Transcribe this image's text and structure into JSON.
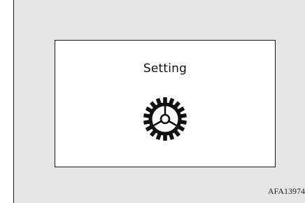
{
  "screen": {
    "title": "Setting",
    "icon": "gear-icon"
  },
  "figure_code": "AFA13974"
}
